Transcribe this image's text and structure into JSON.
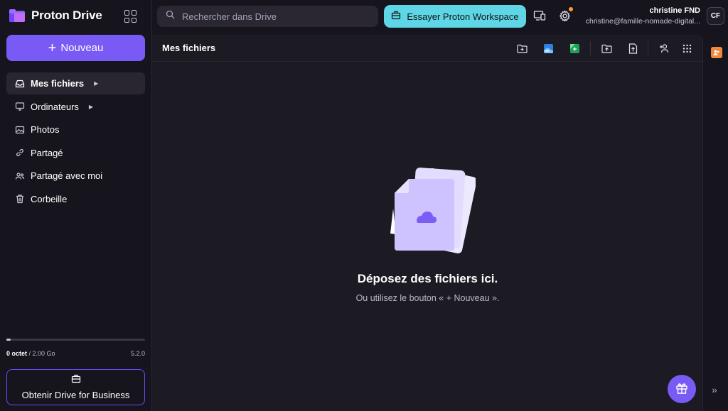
{
  "app": {
    "name": "Proton Drive",
    "brand_color": "#7a5af5",
    "accent_cyan": "#5ed6e6"
  },
  "sidebar": {
    "new_button_label": "Nouveau",
    "items": [
      {
        "label": "Mes fichiers",
        "icon": "inbox-icon",
        "active": true,
        "has_caret": true
      },
      {
        "label": "Ordinateurs",
        "icon": "monitor-icon",
        "active": false,
        "has_caret": true
      },
      {
        "label": "Photos",
        "icon": "image-icon",
        "active": false,
        "has_caret": false
      },
      {
        "label": "Partagé",
        "icon": "link-icon",
        "active": false,
        "has_caret": false
      },
      {
        "label": "Partagé avec moi",
        "icon": "users-icon",
        "active": false,
        "has_caret": false
      },
      {
        "label": "Corbeille",
        "icon": "trash-icon",
        "active": false,
        "has_caret": false
      }
    ],
    "storage": {
      "used": "0 octet",
      "separator": " / ",
      "total": "2.00 Go",
      "version": "5.2.0",
      "fill_fraction": 0.03
    },
    "business_button_label": "Obtenir Drive for Business"
  },
  "header": {
    "search_placeholder": "Rechercher dans Drive",
    "workspace_button_label": "Essayer Proton Workspace",
    "user_name": "christine FND",
    "user_email": "christine@famille-nomade-digital...",
    "user_initials": "CF"
  },
  "main": {
    "title": "Mes fichiers",
    "empty_title": "Déposez des fichiers ici.",
    "empty_subtitle": "Ou utilisez le bouton « + Nouveau »."
  }
}
